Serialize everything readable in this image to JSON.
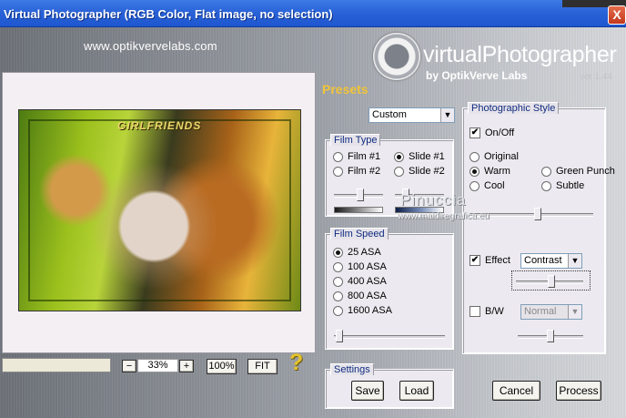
{
  "window": {
    "title": "Virtual Photographer (RGB Color, Flat image, no selection)",
    "close_label": "X"
  },
  "branding": {
    "website": "www.optikvervelabs.com",
    "product": "virtualPhotographer",
    "company": "by OptikVerve Labs",
    "version": "ver 1.44"
  },
  "preview": {
    "image_caption": "GIRLFRIENDS",
    "watermark": "Pinuccia",
    "watermark_url": "www.maidiregrafica.eu"
  },
  "zoom": {
    "minus": "−",
    "value": "33%",
    "plus": "+",
    "btn_100": "100%",
    "btn_fit": "FIT",
    "help": "?"
  },
  "presets": {
    "label": "Presets",
    "selected": "Custom"
  },
  "film_type": {
    "title": "Film Type",
    "options": [
      "Film #1",
      "Slide #1",
      "Film #2",
      "Slide #2"
    ],
    "selected": "Slide #1",
    "slider1_value": 0.6,
    "slider2_value": 0.3
  },
  "film_speed": {
    "title": "Film Speed",
    "options": [
      "25 ASA",
      "100 ASA",
      "400 ASA",
      "800 ASA",
      "1600 ASA"
    ],
    "selected": "25 ASA",
    "slider_value": 0.05
  },
  "photographic_style": {
    "title": "Photographic Style",
    "onoff_label": "On/Off",
    "onoff_checked": true,
    "styles": [
      "Original",
      "Warm",
      "Green Punch",
      "Cool",
      "Subtle"
    ],
    "selected": "Warm",
    "style_slider_value": 0.55,
    "effect_label": "Effect",
    "effect_checked": true,
    "effect_selected": "Contrast",
    "effect_slider_value": 0.55,
    "bw_label": "B/W",
    "bw_checked": false,
    "bw_selected": "Normal",
    "bw_slider_value": 0.5
  },
  "settings": {
    "title": "Settings",
    "save": "Save",
    "load": "Load"
  },
  "actions": {
    "cancel": "Cancel",
    "process": "Process"
  }
}
